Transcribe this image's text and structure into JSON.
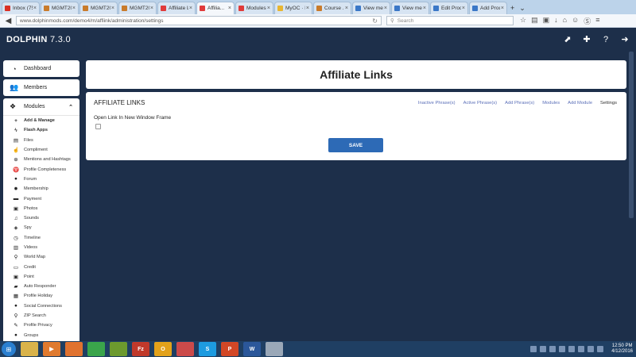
{
  "browser": {
    "tabs": [
      {
        "label": "Inbox (75...",
        "color": "#d93025",
        "active": false
      },
      {
        "label": "MGMT20...",
        "color": "#c97b2b",
        "active": false
      },
      {
        "label": "MGMT20...",
        "color": "#c97b2b",
        "active": false
      },
      {
        "label": "MGMT20...",
        "color": "#c97b2b",
        "active": false
      },
      {
        "label": "Affiliate L...",
        "color": "#e03a3a",
        "active": false
      },
      {
        "label": "Affilia...",
        "color": "#e03a3a",
        "active": true
      },
      {
        "label": "Modules",
        "color": "#e03a3a",
        "active": false
      },
      {
        "label": "MyOC · D...",
        "color": "#e8b631",
        "active": false
      },
      {
        "label": "Course ...",
        "color": "#c97b2b",
        "active": false
      },
      {
        "label": "View mes...",
        "color": "#3a77c7",
        "active": false
      },
      {
        "label": "View mes...",
        "color": "#3a77c7",
        "active": false
      },
      {
        "label": "Edit Prod...",
        "color": "#3a77c7",
        "active": false
      },
      {
        "label": "Add Prod...",
        "color": "#3a77c7",
        "active": false
      }
    ],
    "url": "www.dolphinmods.com/demo4/m/affiink/administration/settings",
    "search_placeholder": "Search"
  },
  "header": {
    "brand": "DOLPHIN",
    "version": "7.3.0"
  },
  "sidebar": {
    "dashboard_label": "Dashboard",
    "members_label": "Members",
    "modules_label": "Modules",
    "modules": [
      {
        "label": "Add & Manage",
        "icon": "plus-icon",
        "glyph": "+",
        "bold": true
      },
      {
        "label": "Flash Apps",
        "icon": "bolt-icon",
        "glyph": "ϟ",
        "bold": true
      },
      {
        "label": "Files",
        "icon": "file-icon",
        "glyph": "▤",
        "bold": false
      },
      {
        "label": "Compliment",
        "icon": "thumbs-up-icon",
        "glyph": "☝",
        "bold": false
      },
      {
        "label": "Mentions and Hashtags",
        "icon": "search-plus-icon",
        "glyph": "⊕",
        "bold": false
      },
      {
        "label": "Profile Completeness",
        "icon": "trophy-icon",
        "glyph": "♈",
        "bold": false
      },
      {
        "label": "Forum",
        "icon": "comments-icon",
        "glyph": "●",
        "bold": false
      },
      {
        "label": "Membership",
        "icon": "badge-icon",
        "glyph": "✹",
        "bold": false
      },
      {
        "label": "Payment",
        "icon": "credit-card-icon",
        "glyph": "▬",
        "bold": false
      },
      {
        "label": "Photos",
        "icon": "picture-icon",
        "glyph": "▣",
        "bold": false
      },
      {
        "label": "Sounds",
        "icon": "music-icon",
        "glyph": "♫",
        "bold": false
      },
      {
        "label": "Spy",
        "icon": "eye-icon",
        "glyph": "◈",
        "bold": false
      },
      {
        "label": "Timeline",
        "icon": "clock-icon",
        "glyph": "◷",
        "bold": false
      },
      {
        "label": "Videos",
        "icon": "film-icon",
        "glyph": "▥",
        "bold": false
      },
      {
        "label": "World Map",
        "icon": "map-marker-icon",
        "glyph": "⚲",
        "bold": false
      },
      {
        "label": "Credit",
        "icon": "money-icon",
        "glyph": "▭",
        "bold": false
      },
      {
        "label": "Point",
        "icon": "point-icon",
        "glyph": "▣",
        "bold": false
      },
      {
        "label": "Auto Responder",
        "icon": "truck-icon",
        "glyph": "▰",
        "bold": false
      },
      {
        "label": "Profile Holiday",
        "icon": "calendar-icon",
        "glyph": "▦",
        "bold": false
      },
      {
        "label": "Social Connections",
        "icon": "globe-icon",
        "glyph": "●",
        "bold": false
      },
      {
        "label": "ZIP Search",
        "icon": "search-icon",
        "glyph": "⚲",
        "bold": false
      },
      {
        "label": "Profile Privacy",
        "icon": "pencil-icon",
        "glyph": "✎",
        "bold": false
      },
      {
        "label": "Groups",
        "icon": "groups-icon",
        "glyph": "●",
        "bold": false
      }
    ]
  },
  "main": {
    "title": "Affiliate Links",
    "panel_heading": "AFFILIATE LINKS",
    "links": [
      {
        "label": "Inactive Phrase(s)",
        "current": false
      },
      {
        "label": "Active Phrase(s)",
        "current": false
      },
      {
        "label": "Add Phrase(s)",
        "current": false
      },
      {
        "label": "Modules",
        "current": false
      },
      {
        "label": "Add Module",
        "current": false
      },
      {
        "label": "Settings",
        "current": true
      }
    ],
    "field_label": "Open Link In New Window Frame",
    "checkbox_checked": false,
    "save_label": "SAVE"
  },
  "taskbar": {
    "apps": [
      {
        "name": "explorer",
        "color": "#d9b34a",
        "glyph": ""
      },
      {
        "name": "media-player",
        "color": "#e07a2f",
        "glyph": "▶"
      },
      {
        "name": "firefox",
        "color": "#e0722f",
        "glyph": ""
      },
      {
        "name": "chrome",
        "color": "#3aa54b",
        "glyph": ""
      },
      {
        "name": "frog-app",
        "color": "#6c9a2e",
        "glyph": ""
      },
      {
        "name": "filezilla",
        "color": "#c0392b",
        "glyph": "Fz"
      },
      {
        "name": "outlook",
        "color": "#e3a21a",
        "glyph": "O"
      },
      {
        "name": "paint",
        "color": "#cc4a4a",
        "glyph": ""
      },
      {
        "name": "skype",
        "color": "#1d9be0",
        "glyph": "S"
      },
      {
        "name": "powerpoint",
        "color": "#d24726",
        "glyph": "P"
      },
      {
        "name": "word",
        "color": "#2b579a",
        "glyph": "W"
      },
      {
        "name": "notepad",
        "color": "#9aa8b8",
        "glyph": ""
      }
    ],
    "time": "12:50 PM",
    "date": "4/12/2016"
  }
}
